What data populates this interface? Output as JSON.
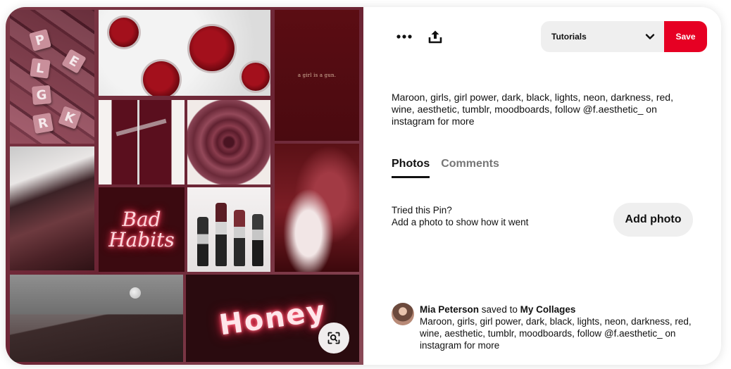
{
  "pin_image": {
    "alt_text": "",
    "overlay_texts": {
      "girl_is_a_gun": "a girl is a gun.",
      "bad": "Bad",
      "habits": "Habits",
      "honey": "Honey",
      "scrabble_letters": [
        "P",
        "L",
        "G",
        "K",
        "R",
        "E"
      ]
    },
    "visual_search_icon": "visual-search-icon"
  },
  "toolbar": {
    "more_icon": "ellipsis-icon",
    "share_icon": "share-upload-icon",
    "board_select_value": "Tutorials",
    "board_select_icon": "chevron-down-icon",
    "save_label": "Save",
    "save_color": "#e60023"
  },
  "description": "Maroon, girls, girl power, dark, black, lights, neon, darkness, red, wine, aesthetic, tumblr, moodboards, follow @f.aesthetic_ on instagram for more",
  "tabs": [
    {
      "label": "Photos",
      "active": true
    },
    {
      "label": "Comments",
      "active": false
    }
  ],
  "tried_pin": {
    "line1": "Tried this Pin?",
    "line2": "Add a photo to show how it went",
    "add_photo_label": "Add photo"
  },
  "saved_by": {
    "user": "Mia Peterson",
    "verb": "saved to",
    "board": "My Collages",
    "description": "Maroon, girls, girl power, dark, black, lights, neon, darkness, red, wine, aesthetic, tumblr, moodboards, follow @f.aesthetic_ on instagram for more"
  }
}
